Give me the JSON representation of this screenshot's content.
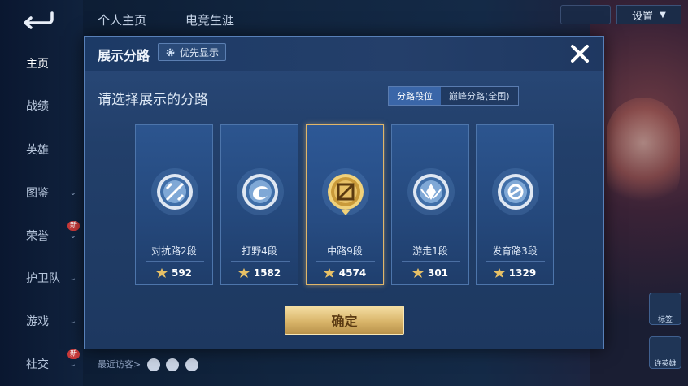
{
  "background": {
    "tabs": [
      "个人主页",
      "电竞生涯"
    ],
    "settings_label": "设置",
    "sidebar": [
      {
        "label": "主页",
        "active": true
      },
      {
        "label": "战绩"
      },
      {
        "label": "英雄"
      },
      {
        "label": "图鉴",
        "chevron": true
      },
      {
        "label": "荣誉",
        "chevron": true,
        "badge": "新"
      },
      {
        "label": "护卫队",
        "chevron": true
      },
      {
        "label": "游戏",
        "chevron": true
      },
      {
        "label": "社交",
        "chevron": true,
        "badge": "新"
      }
    ],
    "recent_visitors_label": "最近访客>",
    "right_buttons": [
      "标签",
      "许英雄"
    ]
  },
  "modal": {
    "title": "展示分路",
    "priority_label": "优先显示",
    "prompt": "请选择展示的分路",
    "segments": [
      {
        "label": "分路段位",
        "active": true
      },
      {
        "label": "巅峰分路(全国)",
        "active": false
      }
    ],
    "lanes": [
      {
        "name": "对抗路2段",
        "points": "592",
        "icon": "clash-lane-emblem",
        "tier": "silver",
        "selected": false
      },
      {
        "name": "打野4段",
        "points": "1582",
        "icon": "jungle-emblem",
        "tier": "silver",
        "selected": false
      },
      {
        "name": "中路9段",
        "points": "4574",
        "icon": "mid-lane-emblem",
        "tier": "gold",
        "selected": true
      },
      {
        "name": "游走1段",
        "points": "301",
        "icon": "roam-emblem",
        "tier": "silver",
        "selected": false
      },
      {
        "name": "发育路3段",
        "points": "1329",
        "icon": "farm-lane-emblem",
        "tier": "silver",
        "selected": false
      }
    ],
    "confirm_label": "确定"
  },
  "colors": {
    "modal_bg": "#223f6a",
    "selected_border": "#e0b66a",
    "confirm_gold": "#d9b56a",
    "segment_active": "#3a66a8"
  }
}
